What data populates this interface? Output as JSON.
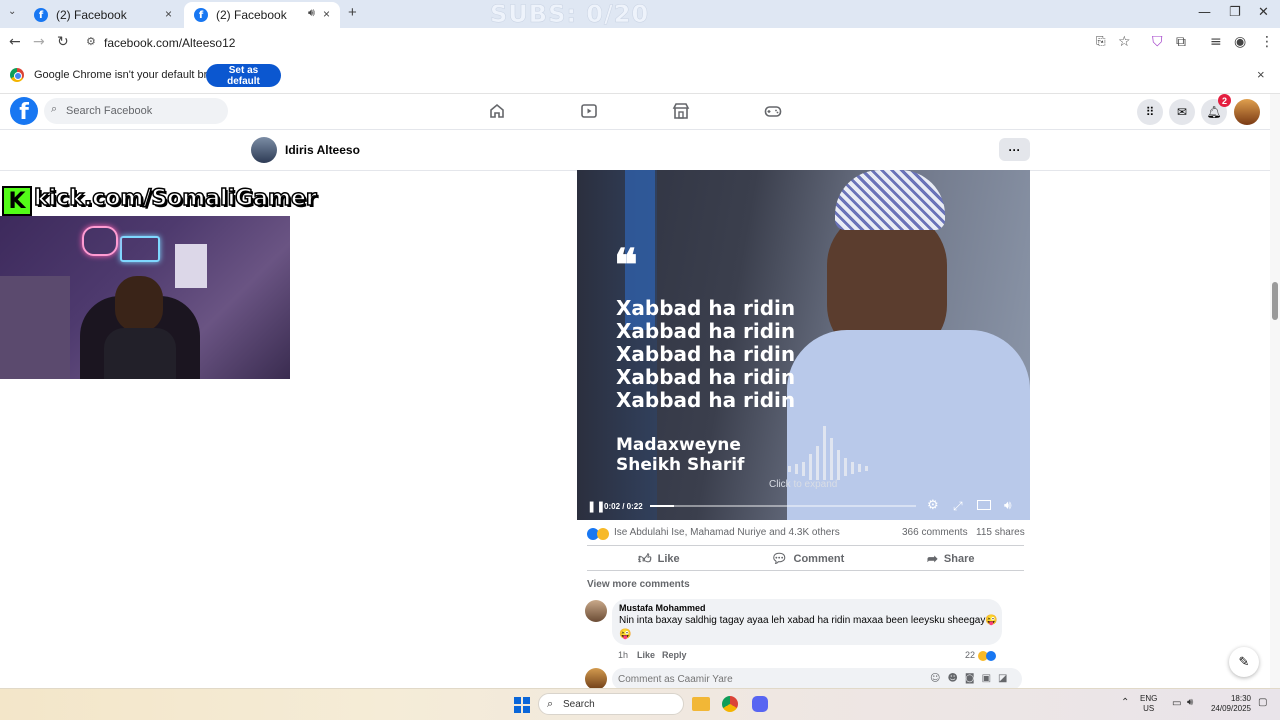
{
  "browser": {
    "tabs": [
      {
        "title": "(2) Facebook",
        "close": "×"
      },
      {
        "title": "(2) Facebook",
        "close": "×"
      }
    ],
    "new_tab": "+",
    "url": "facebook.com/Alteeso12",
    "stream_overlay": "SUBS: 0/20",
    "infobar_text": "Google Chrome isn't your default browser",
    "set_default_label": "Set as default",
    "infobar_close": "×"
  },
  "facebook": {
    "logo": "f",
    "search_placeholder": "Search Facebook",
    "notifications_count": "2",
    "more_label": "···"
  },
  "page": {
    "name": "Idiris Alteeso"
  },
  "webcam": {
    "kick_logo": "K",
    "kick_text": "kick.com/SomaliGamer"
  },
  "video": {
    "quote_mark": "❝",
    "lines": [
      "Xabbad ha ridin",
      "Xabbad ha ridin",
      "Xabbad ha ridin",
      "Xabbad ha ridin",
      "Xabbad ha ridin"
    ],
    "speaker_title": "Madaxweyne",
    "speaker_name": "Sheikh Sharif",
    "click_to_expand": "Click to expand",
    "time": "0:02 / 0:22",
    "progress_fraction": 0.09
  },
  "post": {
    "reaction_names": "Ise Abdulahi Ise, Mahamad Nuriye and 4.3K others",
    "comments_count": "366 comments",
    "shares_count": "115 shares",
    "like_label": "Like",
    "comment_label": "Comment",
    "share_label": "Share",
    "view_more": "View more comments"
  },
  "comment": {
    "author": "Mustafa Mohammed",
    "text": "Nin inta baxay saldhig tagay ayaa leh xabad ha ridin maxaa been leeysku sheegay😜",
    "emoji_line": "😜",
    "time": "1h",
    "like": "Like",
    "reply": "Reply",
    "reaction_count": "22"
  },
  "comment_input": {
    "placeholder": "Comment as Caamir Yare"
  },
  "taskbar": {
    "search_label": "Search",
    "lang_top": "ENG",
    "lang_bottom": "US",
    "time": "18:30",
    "date": "24/09/2025"
  },
  "colors": {
    "facebook_blue": "#1877f2",
    "chrome_button": "#0b57d0",
    "notification_red": "#e41e3f",
    "kick_green": "#53fc18"
  }
}
